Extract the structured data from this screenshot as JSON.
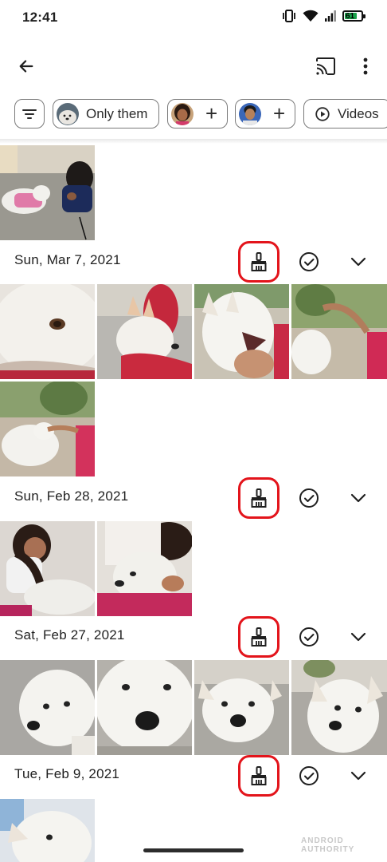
{
  "status_bar": {
    "time": "12:41",
    "battery": "61"
  },
  "top_bar": {
    "back_icon": "arrow-back-icon",
    "cast_icon": "cast-icon",
    "more_icon": "more-vert-icon"
  },
  "chips": {
    "filter_icon": "filter-list-icon",
    "only_them": "Only them",
    "add_person_1": "+",
    "add_person_2": "+",
    "videos": "Videos"
  },
  "sections": [
    {
      "date": "Sun, Mar 7, 2021",
      "clean_icon": "broom-icon",
      "select_icon": "check-circle-icon",
      "expand_icon": "chevron-down-icon"
    },
    {
      "date": "Sun, Feb 28, 2021",
      "clean_icon": "broom-icon",
      "select_icon": "check-circle-icon",
      "expand_icon": "chevron-down-icon"
    },
    {
      "date": "Sat, Feb 27, 2021",
      "clean_icon": "broom-icon",
      "select_icon": "check-circle-icon",
      "expand_icon": "chevron-down-icon"
    },
    {
      "date": "Tue, Feb 9, 2021",
      "clean_icon": "broom-icon",
      "select_icon": "check-circle-icon",
      "expand_icon": "chevron-down-icon"
    }
  ],
  "watermark": "ANDROID AUTHORITY",
  "colors": {
    "highlight": "#e3141b",
    "chip_border": "#7a7a7a"
  }
}
